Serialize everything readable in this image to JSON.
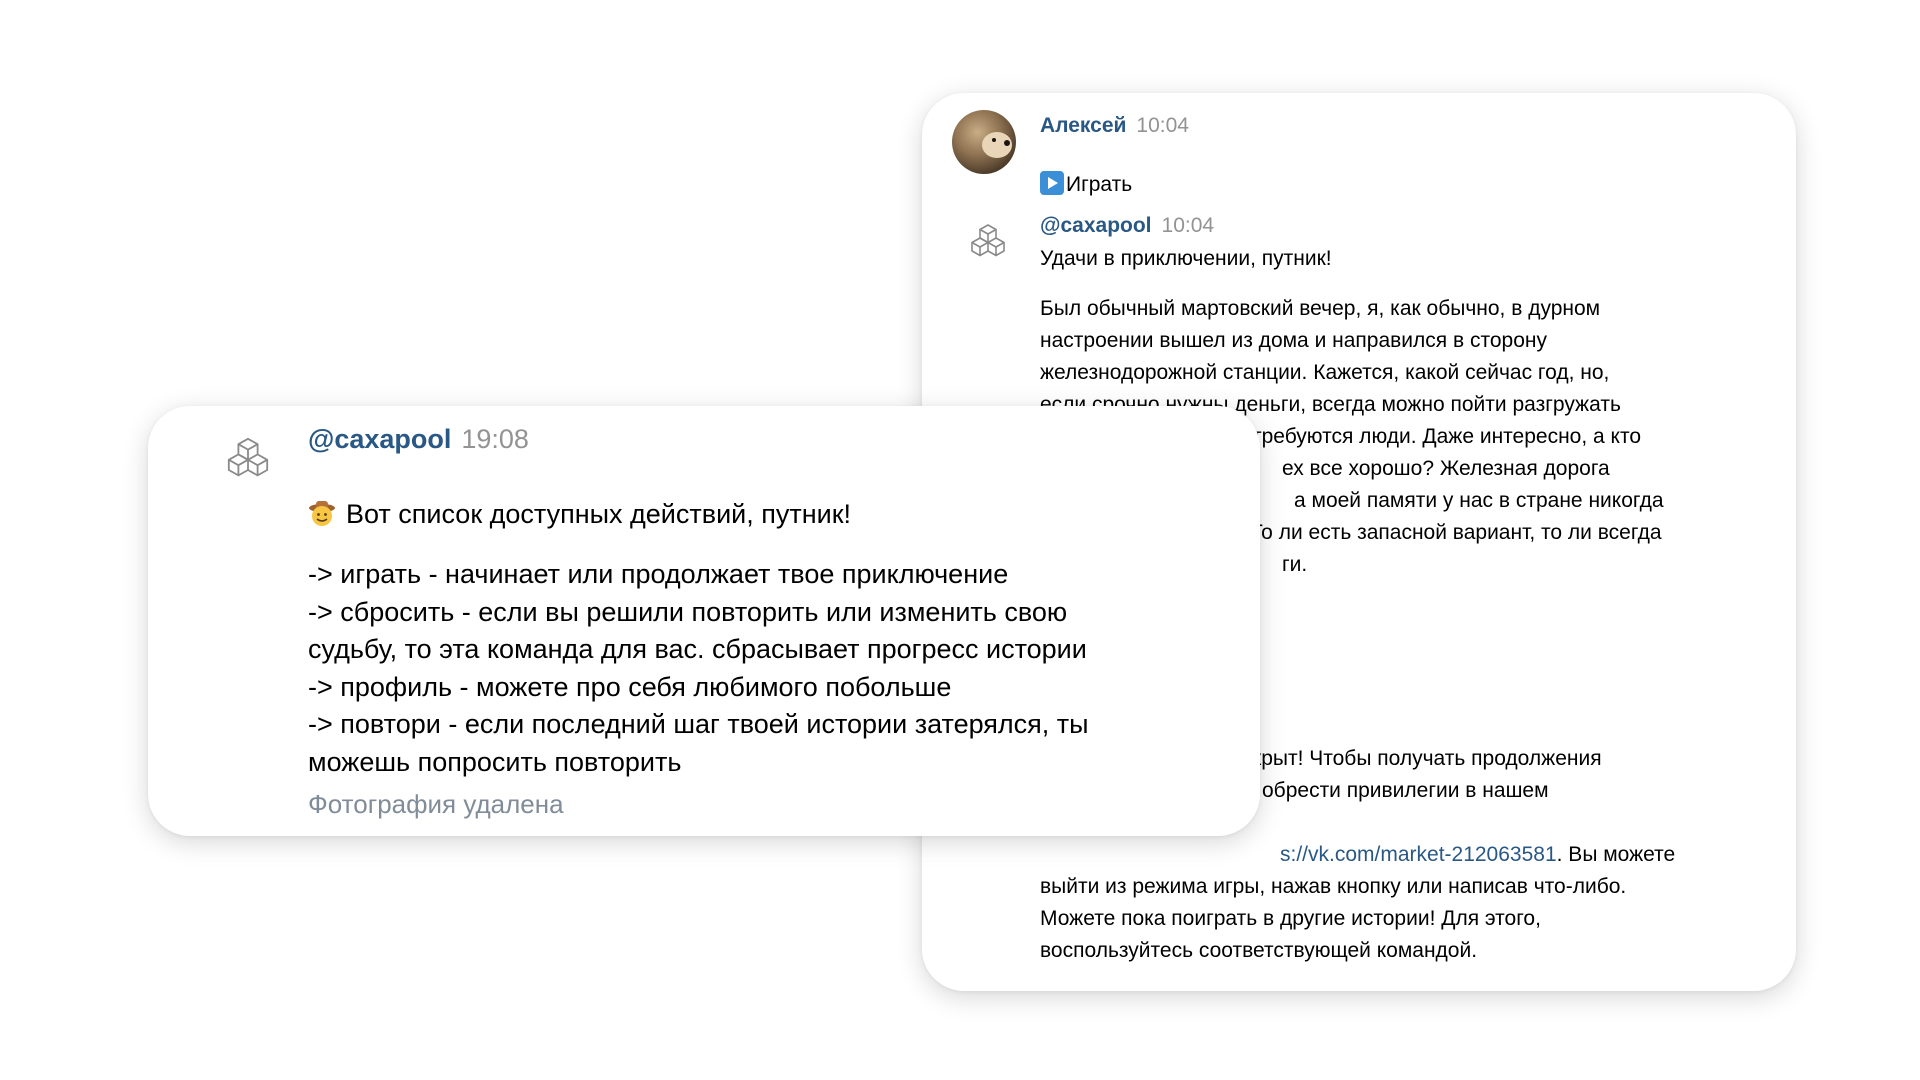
{
  "back_card": {
    "message1": {
      "author": "Алексей",
      "time": "10:04",
      "text": "Играть",
      "icon": "play-icon"
    },
    "message2": {
      "author": "@caxapool",
      "time": "10:04",
      "greeting": "Удачи в приключении, путник!",
      "story_lines": [
        "Был обычный мартовский вечер, я, как обычно, в дурном",
        "настроении вышел из дома и направился в сторону",
        "железнодорожной станции. Кажется, какой сейчас год, но,",
        "если срочно нужны деньги, всегда можно пойти разгружать",
        "требуются люди. Даже интересно, а кто",
        "ех все хорошо? Железная дорога",
        "а моей памяти у нас в стране никогда",
        "То ли есть запасной вариант, то ли всегда",
        "ги."
      ],
      "tail_lines": [
        "крыт! Чтобы получать продолжения",
        "обрести привилегии в нашем"
      ],
      "link_prefix_partial": "s://vk.com/market-212063581",
      "link_suffix": ". Вы можете",
      "final_lines": [
        "выйти из режима игры, нажав кнопку или написав что-либо.",
        "Можете пока поиграть в другие истории! Для этого,",
        "воспользуйтесь соответствующей командой."
      ]
    }
  },
  "front_card": {
    "author": "@caxapool",
    "time": "19:08",
    "intro": "Вот список доступных действий, путник!",
    "intro_icon": "cowboy-emoji-icon",
    "lines": [
      "-> играть - начинает или продолжает твое приключение",
      "-> сбросить - если вы решили повторить или изменить свою",
      "судьбу, то эта команда для вас. сбрасывает прогресс истории",
      "-> профиль - можете про себя любимого побольше",
      "-> повтори - если последний шаг твоей истории затерялся, ты",
      "можешь попросить повторить"
    ],
    "deleted_photo": "Фотография удалена"
  },
  "colors": {
    "author": "#2a5885",
    "time": "#939393",
    "deleted": "#818c99",
    "text": "#000000"
  }
}
